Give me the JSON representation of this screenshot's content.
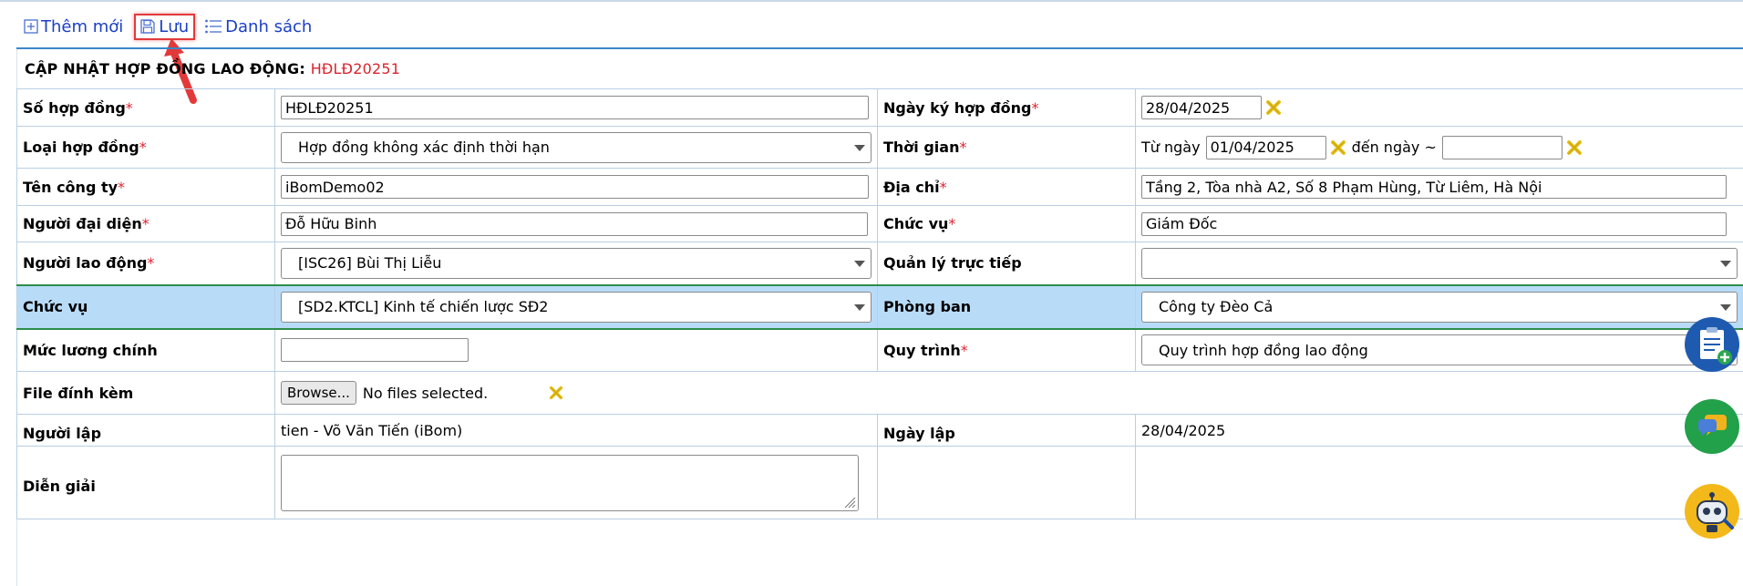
{
  "toolbar": {
    "add_label": "Thêm mới",
    "save_label": "Lưu",
    "list_label": "Danh sách"
  },
  "heading": {
    "title": "CẬP NHẬT HỢP ĐỒNG LAO ĐỘNG:",
    "code": "HĐLĐ20251"
  },
  "form": {
    "contract_no": {
      "label": "Số hợp đồng",
      "req": "*",
      "value": "HĐLĐ20251"
    },
    "sign_date": {
      "label": "Ngày ký hợp đồng",
      "req": "*",
      "value": "28/04/2025"
    },
    "contract_type": {
      "label": "Loại hợp đồng",
      "req": "*",
      "value": "Hợp đồng không xác định thời hạn"
    },
    "period": {
      "label": "Thời gian",
      "req": "*",
      "from_label": "Từ ngày",
      "from_value": "01/04/2025",
      "to_label": "đến ngày ~",
      "to_value": ""
    },
    "company": {
      "label": "Tên công ty",
      "req": "*",
      "value": "iBomDemo02"
    },
    "address": {
      "label": "Địa chỉ",
      "req": "*",
      "value": "Tầng 2, Tòa nhà A2, Số 8 Phạm Hùng, Từ Liêm, Hà Nội"
    },
    "representative": {
      "label": "Người đại diện",
      "req": "*",
      "value": "Đỗ Hữu Binh"
    },
    "rep_position": {
      "label": "Chức vụ",
      "req": "*",
      "value": "Giám Đốc"
    },
    "employee": {
      "label": "Người lao động",
      "req": "*",
      "value": "[ISC26] Bùi Thị Liễu"
    },
    "manager": {
      "label": "Quản lý trực tiếp",
      "value": ""
    },
    "position": {
      "label": "Chức vụ",
      "value": "[SD2.KTCL] Kinh tế chiến lược SĐ2"
    },
    "department": {
      "label": "Phòng ban",
      "value": "Công ty Đèo Cả"
    },
    "salary": {
      "label": "Mức lương chính",
      "value": ""
    },
    "process": {
      "label": "Quy trình",
      "req": "*",
      "value": "Quy trình hợp đồng lao động"
    },
    "attachment": {
      "label": "File đính kèm",
      "browse": "Browse...",
      "status": "No files selected."
    },
    "creator": {
      "label": "Người lập",
      "value": "tien - Võ Văn Tiến (iBom)"
    },
    "created_date": {
      "label": "Ngày lập",
      "value": "28/04/2025"
    },
    "description": {
      "label": "Diễn giải",
      "value": ""
    }
  },
  "icons": {
    "add": "plus-square-icon",
    "save": "floppy-disk-icon",
    "list": "list-icon",
    "clear": "clear-x-icon",
    "fab_task": "clipboard-add-icon",
    "fab_chat": "chat-icon",
    "fab_bot": "robot-support-icon"
  },
  "colors": {
    "link": "#1a3fc4",
    "required": "#e0222f",
    "highlight_row": "#b8dcf8",
    "clear_icon": "#e7c21a"
  }
}
